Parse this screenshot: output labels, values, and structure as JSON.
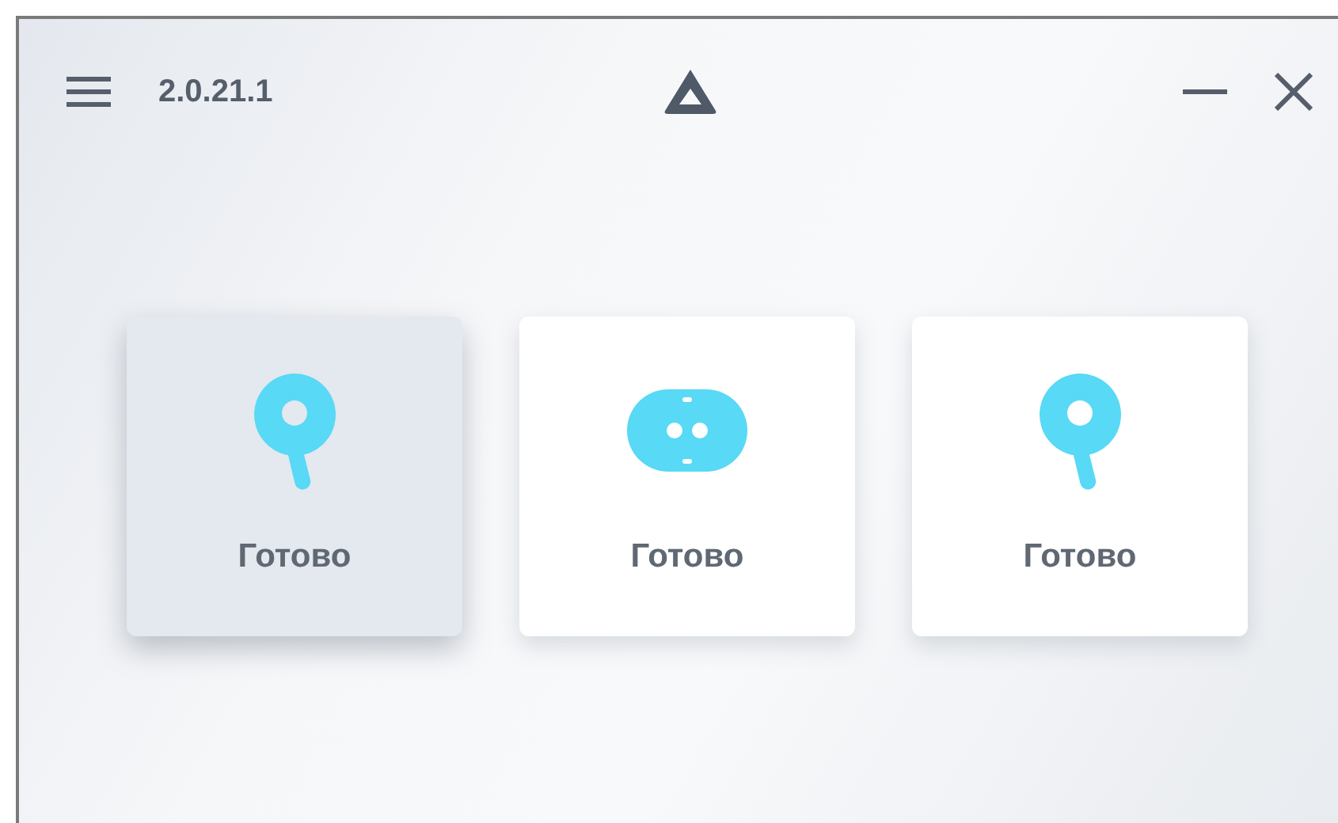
{
  "header": {
    "version": "2.0.21.1"
  },
  "devices": [
    {
      "kind": "controller",
      "status": "Готово",
      "selected": true
    },
    {
      "kind": "headset",
      "status": "Готово",
      "selected": false
    },
    {
      "kind": "controller",
      "status": "Готово",
      "selected": false
    }
  ]
}
